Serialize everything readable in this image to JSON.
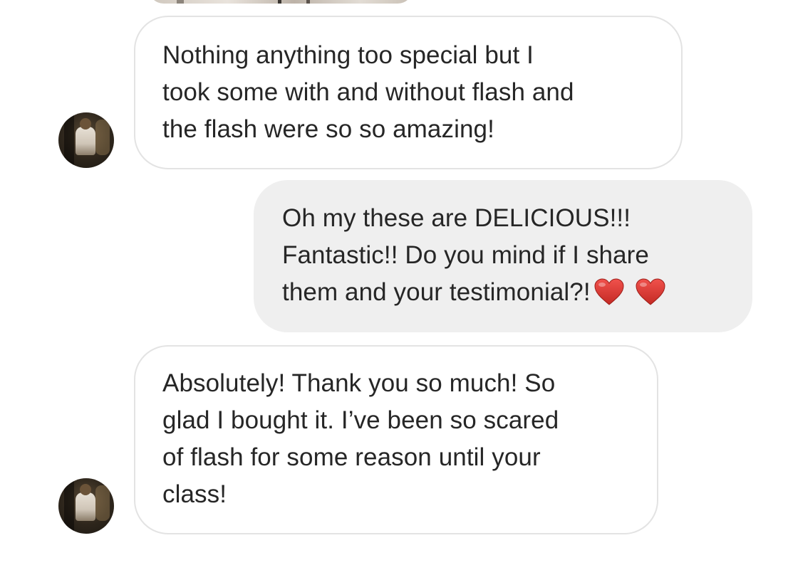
{
  "conversation": {
    "messages": [
      {
        "sender": "other",
        "lines": [
          "Nothing anything too special but I",
          "took some with and without flash and",
          "the flash were so so amazing!"
        ]
      },
      {
        "sender": "me",
        "lines": [
          "Oh my these are DELICIOUS!!!",
          "Fantastic!!  Do you mind if I share",
          "them and your testimonial?!"
        ],
        "emoji": [
          "red-heart",
          "red-heart"
        ]
      },
      {
        "sender": "other",
        "lines": [
          "Absolutely! Thank you so much! So",
          "glad I bought it. I’ve been so scared",
          "of flash for some reason until your",
          "class!"
        ]
      }
    ]
  },
  "colors": {
    "incoming_bubble_border": "#e3e3e3",
    "outgoing_bubble_bg": "#efefef",
    "text": "#262626",
    "heart": "#d32f2f"
  }
}
